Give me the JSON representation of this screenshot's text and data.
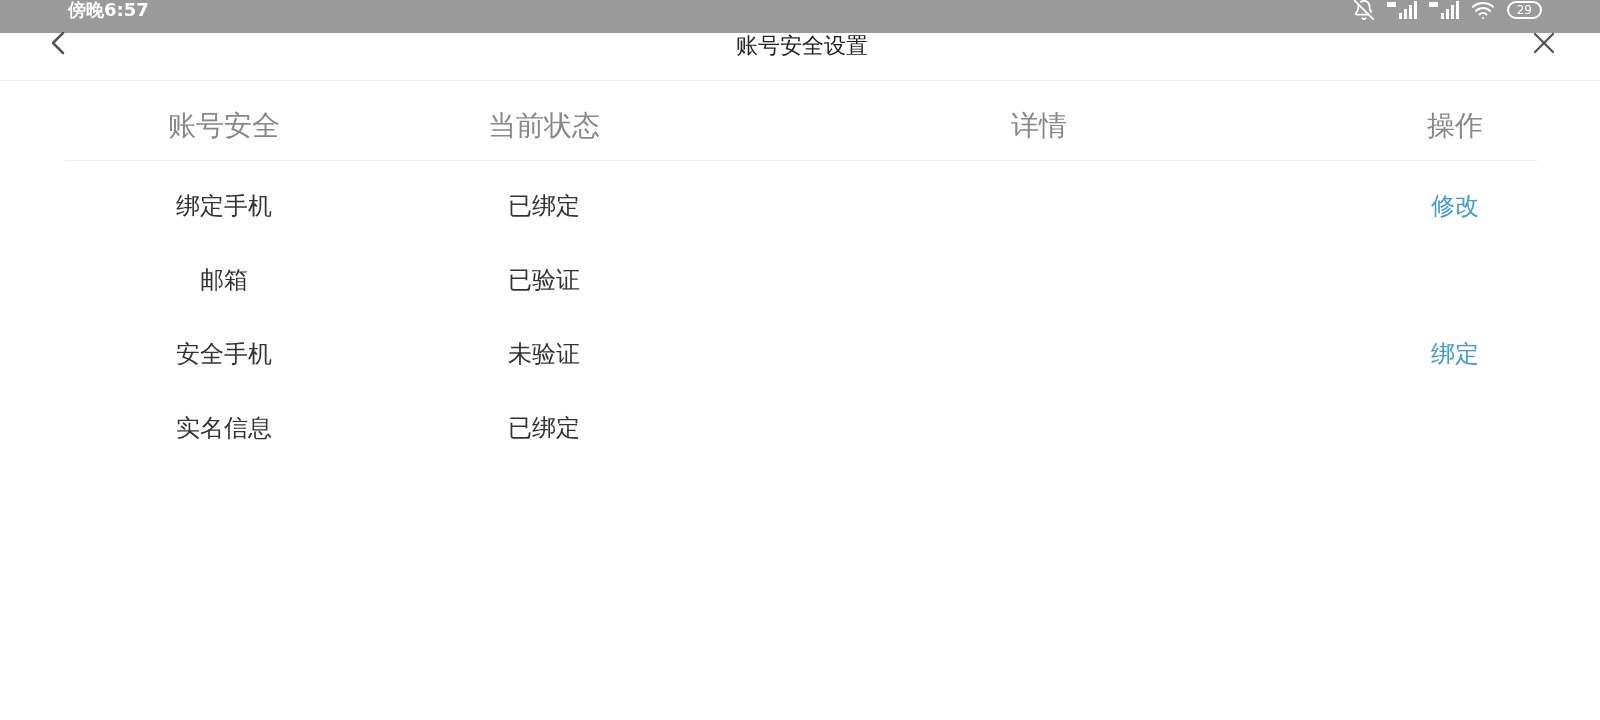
{
  "status_bar": {
    "time": "傍晚6:57",
    "battery": "29"
  },
  "header": {
    "title": "账号安全设置"
  },
  "table": {
    "columns": [
      "账号安全",
      "当前状态",
      "详情",
      "操作"
    ],
    "rows": [
      {
        "item": "绑定手机",
        "status": "已绑定",
        "action": "修改"
      },
      {
        "item": "邮箱",
        "status": "已验证"
      },
      {
        "item": "安全手机",
        "status": "未验证",
        "action": "绑定"
      },
      {
        "item": "实名信息",
        "status": "已绑定"
      }
    ]
  }
}
